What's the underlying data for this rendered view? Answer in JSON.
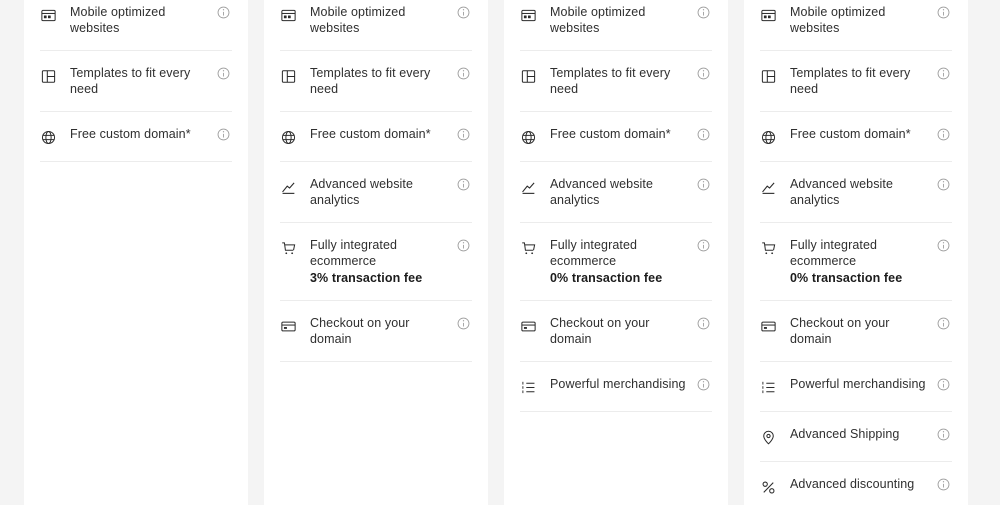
{
  "theme": {
    "page_background": "#f4f4f4",
    "card_background": "#ffffff",
    "text_color": "#2f2f2f",
    "divider_color": "#ececec",
    "info_icon_color": "#9a9a9a"
  },
  "columns": [
    {
      "id": "plan-column-1",
      "features": [
        {
          "icon": "browser-window-icon",
          "label": "Mobile optimized websites",
          "sub": "",
          "info": "info-icon"
        },
        {
          "icon": "layout-template-icon",
          "label": "Templates to fit every need",
          "sub": "",
          "info": "info-icon"
        },
        {
          "icon": "globe-icon",
          "label": "Free custom domain*",
          "sub": "",
          "info": "info-icon"
        }
      ]
    },
    {
      "id": "plan-column-2",
      "features": [
        {
          "icon": "browser-window-icon",
          "label": "Mobile optimized websites",
          "sub": "",
          "info": "info-icon"
        },
        {
          "icon": "layout-template-icon",
          "label": "Templates to fit every need",
          "sub": "",
          "info": "info-icon"
        },
        {
          "icon": "globe-icon",
          "label": "Free custom domain*",
          "sub": "",
          "info": "info-icon"
        },
        {
          "icon": "analytics-chart-icon",
          "label": "Advanced website analytics",
          "sub": "",
          "info": "info-icon"
        },
        {
          "icon": "shopping-cart-icon",
          "label": "Fully integrated ecommerce",
          "sub": "3% transaction fee",
          "info": "info-icon"
        },
        {
          "icon": "credit-card-icon",
          "label": "Checkout on your domain",
          "sub": "",
          "info": "info-icon"
        }
      ]
    },
    {
      "id": "plan-column-3",
      "features": [
        {
          "icon": "browser-window-icon",
          "label": "Mobile optimized websites",
          "sub": "",
          "info": "info-icon"
        },
        {
          "icon": "layout-template-icon",
          "label": "Templates to fit every need",
          "sub": "",
          "info": "info-icon"
        },
        {
          "icon": "globe-icon",
          "label": "Free custom domain*",
          "sub": "",
          "info": "info-icon"
        },
        {
          "icon": "analytics-chart-icon",
          "label": "Advanced website analytics",
          "sub": "",
          "info": "info-icon"
        },
        {
          "icon": "shopping-cart-icon",
          "label": "Fully integrated ecommerce",
          "sub": "0% transaction fee",
          "info": "info-icon"
        },
        {
          "icon": "credit-card-icon",
          "label": "Checkout on your domain",
          "sub": "",
          "info": "info-icon"
        },
        {
          "icon": "ordered-list-icon",
          "label": "Powerful merchandising",
          "sub": "",
          "info": "info-icon"
        }
      ]
    },
    {
      "id": "plan-column-4",
      "features": [
        {
          "icon": "browser-window-icon",
          "label": "Mobile optimized websites",
          "sub": "",
          "info": "info-icon"
        },
        {
          "icon": "layout-template-icon",
          "label": "Templates to fit every need",
          "sub": "",
          "info": "info-icon"
        },
        {
          "icon": "globe-icon",
          "label": "Free custom domain*",
          "sub": "",
          "info": "info-icon"
        },
        {
          "icon": "analytics-chart-icon",
          "label": "Advanced website analytics",
          "sub": "",
          "info": "info-icon"
        },
        {
          "icon": "shopping-cart-icon",
          "label": "Fully integrated ecommerce",
          "sub": "0% transaction fee",
          "info": "info-icon"
        },
        {
          "icon": "credit-card-icon",
          "label": "Checkout on your domain",
          "sub": "",
          "info": "info-icon"
        },
        {
          "icon": "ordered-list-icon",
          "label": "Powerful merchandising",
          "sub": "",
          "info": "info-icon"
        },
        {
          "icon": "location-pin-icon",
          "label": "Advanced Shipping",
          "sub": "",
          "info": "info-icon"
        },
        {
          "icon": "percent-icon",
          "label": "Advanced discounting",
          "sub": "",
          "info": "info-icon"
        }
      ]
    }
  ]
}
